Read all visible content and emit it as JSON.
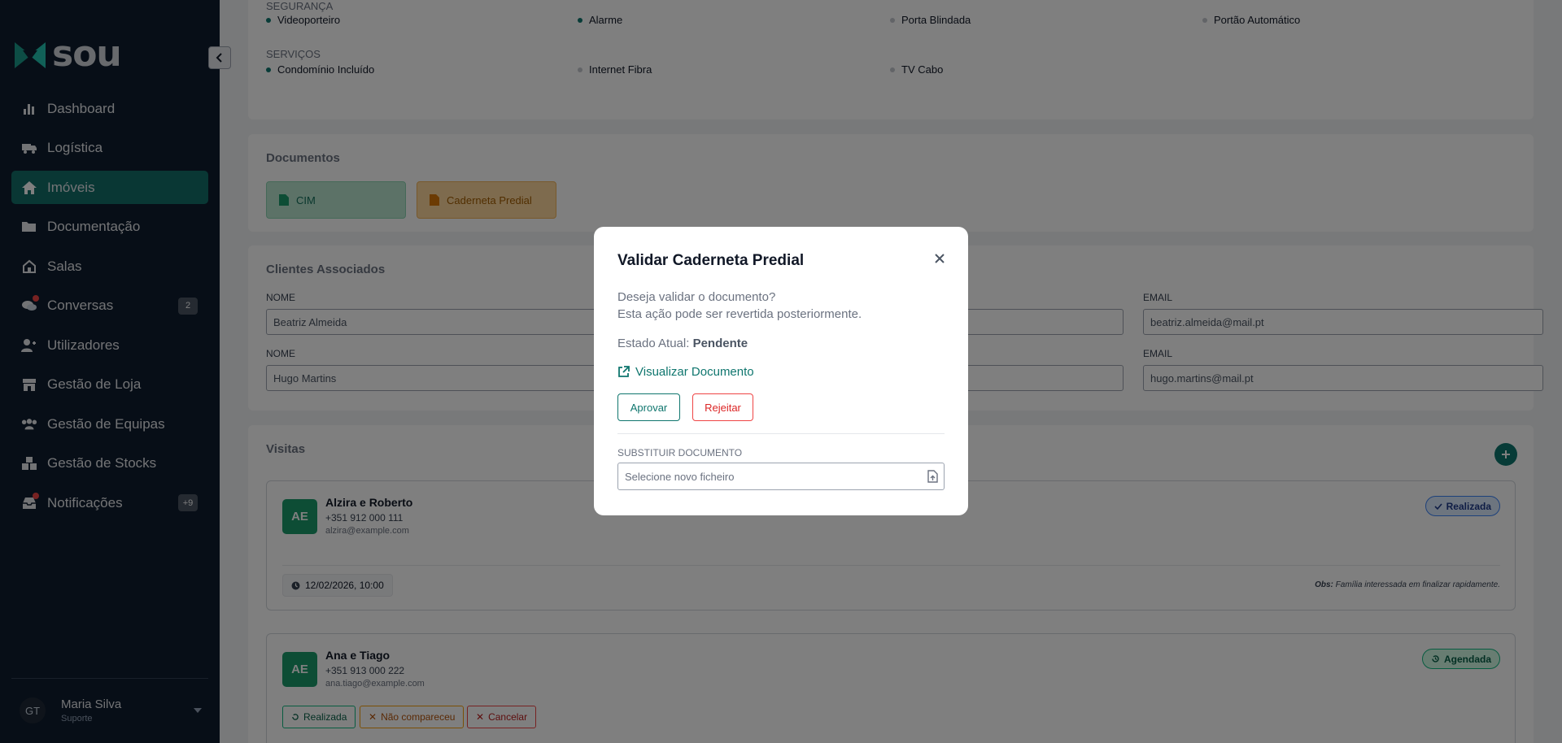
{
  "brand": {
    "name": "sou"
  },
  "sidebar": {
    "items": [
      {
        "label": "Dashboard",
        "icon": "bar-chart-icon"
      },
      {
        "label": "Logística",
        "icon": "truck-icon"
      },
      {
        "label": "Imóveis",
        "icon": "home-icon",
        "active": true
      },
      {
        "label": "Documentação",
        "icon": "folder-icon"
      },
      {
        "label": "Salas",
        "icon": "house-icon"
      },
      {
        "label": "Conversas",
        "icon": "chat-icon",
        "badge": "2"
      },
      {
        "label": "Utilizadores",
        "icon": "users-icon"
      },
      {
        "label": "Gestão de Loja",
        "icon": "store-icon"
      },
      {
        "label": "Gestão de Equipas",
        "icon": "team-icon"
      },
      {
        "label": "Gestão de Stocks",
        "icon": "boxes-icon"
      },
      {
        "label": "Notificações",
        "icon": "inbox-icon",
        "badge": "+9"
      }
    ],
    "user": {
      "initials": "GT",
      "name": "Maria Silva",
      "role": "Suporte"
    }
  },
  "features": {
    "security_label": "SEGURANÇA",
    "security": [
      "Videoporteiro",
      "Alarme",
      "Porta Blindada",
      "Portão Automático"
    ],
    "services_label": "SERVIÇOS",
    "services": [
      "Condomínio Incluído",
      "Internet Fibra",
      "TV Cabo"
    ]
  },
  "documents": {
    "title": "Documentos",
    "items": [
      "CIM",
      "Caderneta Predial"
    ]
  },
  "clients": {
    "title": "Clientes Associados",
    "name_label": "NOME",
    "email_label": "EMAIL",
    "rows": [
      {
        "name": "Beatriz Almeida",
        "email": "beatriz.almeida@mail.pt"
      },
      {
        "name": "Hugo Martins",
        "email": "hugo.martins@mail.pt"
      }
    ]
  },
  "visits": {
    "title": "Visitas",
    "items": [
      {
        "initials": "AE",
        "name": "Alzira e Roberto",
        "phone": "+351 912 000 111",
        "email": "alzira@example.com",
        "status": "Realizada",
        "date": "12/02/2026, 10:00",
        "obs_label": "Obs:",
        "obs": "Família interessada em finalizar rapidamente."
      },
      {
        "initials": "AE",
        "name": "Ana e Tiago",
        "phone": "+351 913 000 222",
        "email": "ana.tiago@example.com",
        "status": "Agendada",
        "actions": [
          "Realizada",
          "Não compareceu",
          "Cancelar"
        ]
      }
    ]
  },
  "modal": {
    "title": "Validar Caderneta Predial",
    "line1": "Deseja validar o documento?",
    "line2": "Esta ação pode ser revertida posteriormente.",
    "state_label": "Estado Atual:",
    "state_value": "Pendente",
    "view_link": "Visualizar Documento",
    "approve": "Aprovar",
    "reject": "Rejeitar",
    "replace_label": "SUBSTITUIR DOCUMENTO",
    "file_placeholder": "Selecione novo ficheiro"
  },
  "colors": {
    "accent": "#0f766e",
    "sidebar_bg": "#0f1d2e",
    "active_bg": "#136e69"
  }
}
